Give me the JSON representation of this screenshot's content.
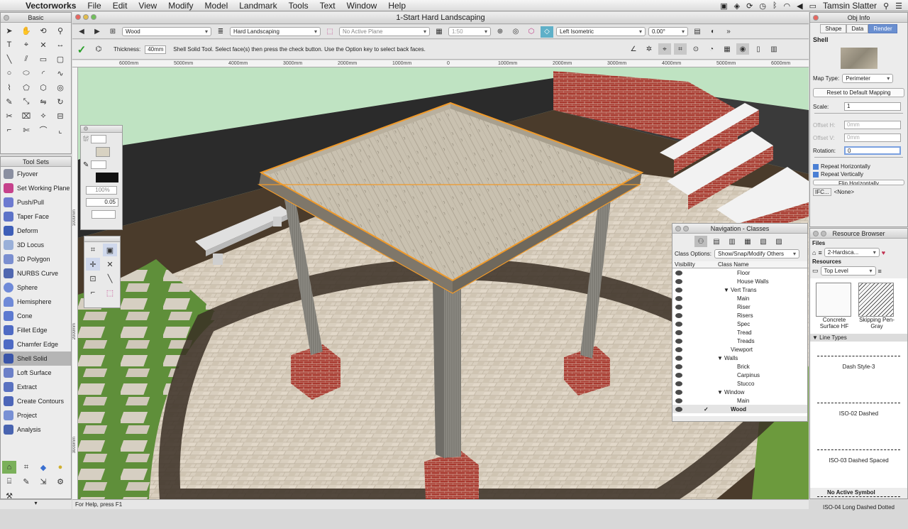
{
  "menubar": {
    "app_name": "Vectorworks",
    "items": [
      "File",
      "Edit",
      "View",
      "Modify",
      "Model",
      "Landmark",
      "Tools",
      "Text",
      "Window",
      "Help"
    ],
    "user": "Tamsin Slatter"
  },
  "document": {
    "title": "1-Start Hard Landscaping"
  },
  "basic_palette": {
    "title": "Basic"
  },
  "toolsets": {
    "title": "Tool Sets",
    "items": [
      "Flyover",
      "Set Working Plane",
      "Push/Pull",
      "Taper Face",
      "Deform",
      "3D Locus",
      "3D Polygon",
      "NURBS Curve",
      "Sphere",
      "Hemisphere",
      "Cone",
      "Fillet Edge",
      "Chamfer Edge",
      "Shell Solid",
      "Loft Surface",
      "Extract",
      "Create Contours",
      "Project",
      "Analysis"
    ],
    "selected": "Shell Solid"
  },
  "view_bar": {
    "class": "Wood",
    "layer": "Hard Landscaping",
    "plane": "No Active Plane",
    "scale": "1:50",
    "view": "Left Isometric",
    "angle": "0.00°"
  },
  "mode_bar": {
    "thickness_label": "Thickness:",
    "thickness_value": "40mm",
    "help_text": "Shell Solid Tool. Select face(s) then press the check button. Use the Option key to select back faces."
  },
  "ruler": {
    "ticks": [
      "6000mm",
      "5000mm",
      "4000mm",
      "3000mm",
      "2000mm",
      "1000mm",
      "0",
      "1000mm",
      "2000mm",
      "3000mm",
      "4000mm",
      "5000mm",
      "6000mm"
    ]
  },
  "ruler_vertical": {
    "ticks": [
      "1000mm",
      "2000mm",
      "3000mm"
    ]
  },
  "attributes": {
    "zoom": "100%",
    "line_weight": "0.05"
  },
  "status_bar": {
    "text": "For Help, press F1"
  },
  "obj_info": {
    "title": "Obj Info",
    "tabs": [
      "Shape",
      "Data",
      "Render"
    ],
    "active_tab": "Render",
    "object_type": "Shell",
    "map_type_label": "Map Type:",
    "map_type_value": "Perimeter",
    "reset_button": "Reset to Default Mapping",
    "scale_label": "Scale:",
    "scale_value": "1",
    "offset_h_label": "Offset H:",
    "offset_h_value": "0mm",
    "offset_v_label": "Offset V:",
    "offset_v_value": "0mm",
    "rotation_label": "Rotation:",
    "rotation_value": "0",
    "repeat_h": "Repeat Horizontally",
    "repeat_v": "Repeat Vertically",
    "flip_h": "Flip Horizontally",
    "ifc_label": "IFC...",
    "ifc_value": "<None>"
  },
  "navigation": {
    "title": "Navigation - Classes",
    "class_options_label": "Class Options:",
    "class_options_value": "Show/Snap/Modify Others",
    "col_visibility": "Visibility",
    "col_class_name": "Class Name",
    "rows": [
      {
        "name": "Floor",
        "indent": 3,
        "toggle": ""
      },
      {
        "name": "House Walls",
        "indent": 3,
        "toggle": ""
      },
      {
        "name": "Vert Trans",
        "indent": 2,
        "toggle": "▼"
      },
      {
        "name": "Main",
        "indent": 3,
        "toggle": ""
      },
      {
        "name": "Riser",
        "indent": 3,
        "toggle": ""
      },
      {
        "name": "Risers",
        "indent": 3,
        "toggle": ""
      },
      {
        "name": "Spec",
        "indent": 3,
        "toggle": ""
      },
      {
        "name": "Tread",
        "indent": 3,
        "toggle": ""
      },
      {
        "name": "Treads",
        "indent": 3,
        "toggle": ""
      },
      {
        "name": "Viewport",
        "indent": 2,
        "toggle": ""
      },
      {
        "name": "Walls",
        "indent": 1,
        "toggle": "▼"
      },
      {
        "name": "Brick",
        "indent": 3,
        "toggle": ""
      },
      {
        "name": "Carpinus",
        "indent": 3,
        "toggle": ""
      },
      {
        "name": "Stucco",
        "indent": 3,
        "toggle": ""
      },
      {
        "name": "Window",
        "indent": 1,
        "toggle": "▼"
      },
      {
        "name": "Main",
        "indent": 3,
        "toggle": ""
      },
      {
        "name": "Wood",
        "indent": 2,
        "toggle": "",
        "active": true
      }
    ]
  },
  "resource_browser": {
    "title": "Resource Browser",
    "files_label": "Files",
    "file_value": "2-Hardsca...",
    "resources_label": "Resources",
    "level_value": "Top Level",
    "thumbs": [
      {
        "label": "Concrete Surface HF"
      },
      {
        "label": "Skipping Pen-Gray"
      }
    ],
    "section": "Line Types",
    "line_types": [
      "Dash Style-3",
      "ISO-02 Dashed",
      "ISO-03 Dashed Spaced",
      "ISO-04 Long Dashed Dotted"
    ],
    "footer": "No Active Symbol"
  }
}
